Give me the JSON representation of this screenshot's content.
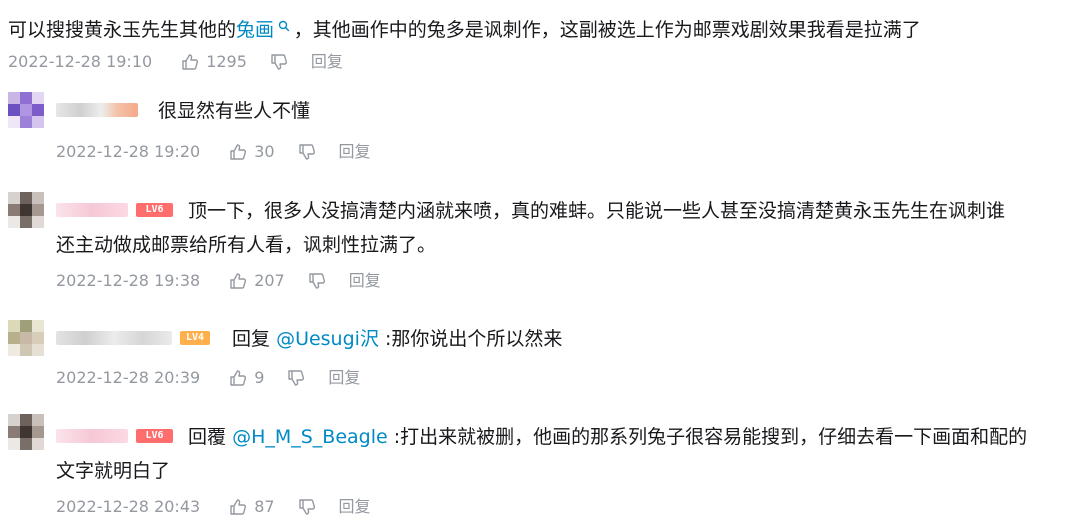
{
  "top_comment": {
    "text_before_link": "可以搜搜黄永玉先生其他的",
    "link_text": "兔画",
    "text_after_link": "，其他画作中的兔多是讽刺作，这副被选上作为邮票戏剧效果我看是拉满了",
    "time": "2022-12-28 19:10",
    "likes": "1295",
    "reply_label": "回复"
  },
  "replies": [
    {
      "level": "",
      "content_lines": [
        "很显然有些人不懂"
      ],
      "time": "2022-12-28 19:20",
      "likes": "30",
      "reply_label": "回复"
    },
    {
      "level": "LV6",
      "content_lines": [
        "顶一下，很多人没搞清楚内涵就来喷，真的难蚌。只能说一些人甚至没搞清楚黄永玉先生在讽刺谁",
        "还主动做成邮票给所有人看，讽刺性拉满了。"
      ],
      "time": "2022-12-28 19:38",
      "likes": "207",
      "reply_label": "回复"
    },
    {
      "level": "LV4",
      "prefix": "回复",
      "mention": "@Uesugi沢",
      "content_after": " :那你说出个所以然来",
      "time": "2022-12-28 20:39",
      "likes": "9",
      "reply_label": "回复"
    },
    {
      "level": "LV6",
      "prefix": "回覆",
      "mention": "@H_M_S_Beagle",
      "content_after": " :打出来就被删，他画的那系列兔子很容易能搜到，仔细去看一下画面和配的",
      "content_line2": "文字就明白了",
      "time": "2022-12-28 20:43",
      "likes": "87",
      "reply_label": "回复"
    }
  ],
  "icons": [
    "search-icon",
    "thumb-up-icon",
    "thumb-down-icon"
  ],
  "colors": {
    "link": "#008ac5",
    "meta": "#9499a0",
    "text": "#18191c",
    "lv6": "#ff6d6d",
    "lv4": "#ffb04d"
  }
}
